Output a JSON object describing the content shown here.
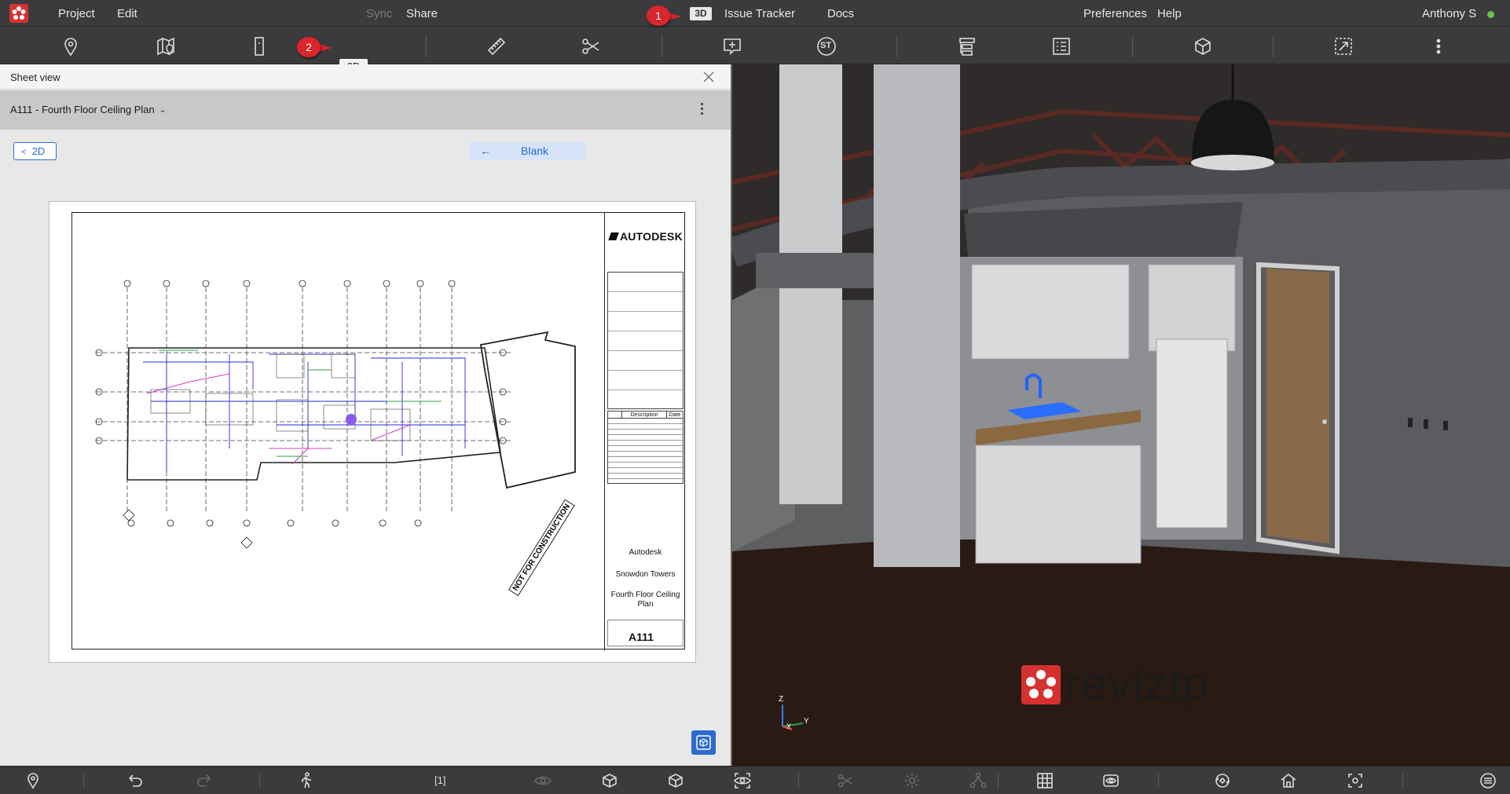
{
  "menu": {
    "project": "Project",
    "edit": "Edit",
    "sync": "Sync",
    "share": "Share",
    "mode_3d": "3D",
    "issue_tracker": "Issue Tracker",
    "docs": "Docs",
    "preferences": "Preferences",
    "help": "Help",
    "user": "Anthony S"
  },
  "toolbar": {
    "toggle_top": "2D",
    "toggle_bottom": "3D",
    "st_label": "ST"
  },
  "callouts": {
    "one": "1",
    "two": "2"
  },
  "sheet_view": {
    "title": "Sheet view",
    "sheet_name": "A111 - Fourth Floor Ceiling Plan",
    "back_2d": "2D",
    "blank": "Blank",
    "drawing": {
      "logo": "AUTODESK",
      "company": "Autodesk",
      "project": "Snowdon Towers",
      "sheet_title": "Fourth Floor Ceiling Plan",
      "sheet_number": "A111",
      "stamp": "NOT FOR CONSTRUCTION",
      "revision_header_desc": "Description",
      "revision_header_date": "Date"
    }
  },
  "viewport": {
    "brand": "revizto",
    "brand_tagline": "INTEGRATED COLLABORATION PLATFORM",
    "axis_z": "Z",
    "axis_y": "Y",
    "axis_x": "X"
  },
  "bottombar": {
    "view_counter": "[1]"
  },
  "colors": {
    "accent": "#2d6ad0",
    "callout": "#d8262a",
    "brand_red": "#d6312f",
    "status_online": "#6cc04a"
  }
}
